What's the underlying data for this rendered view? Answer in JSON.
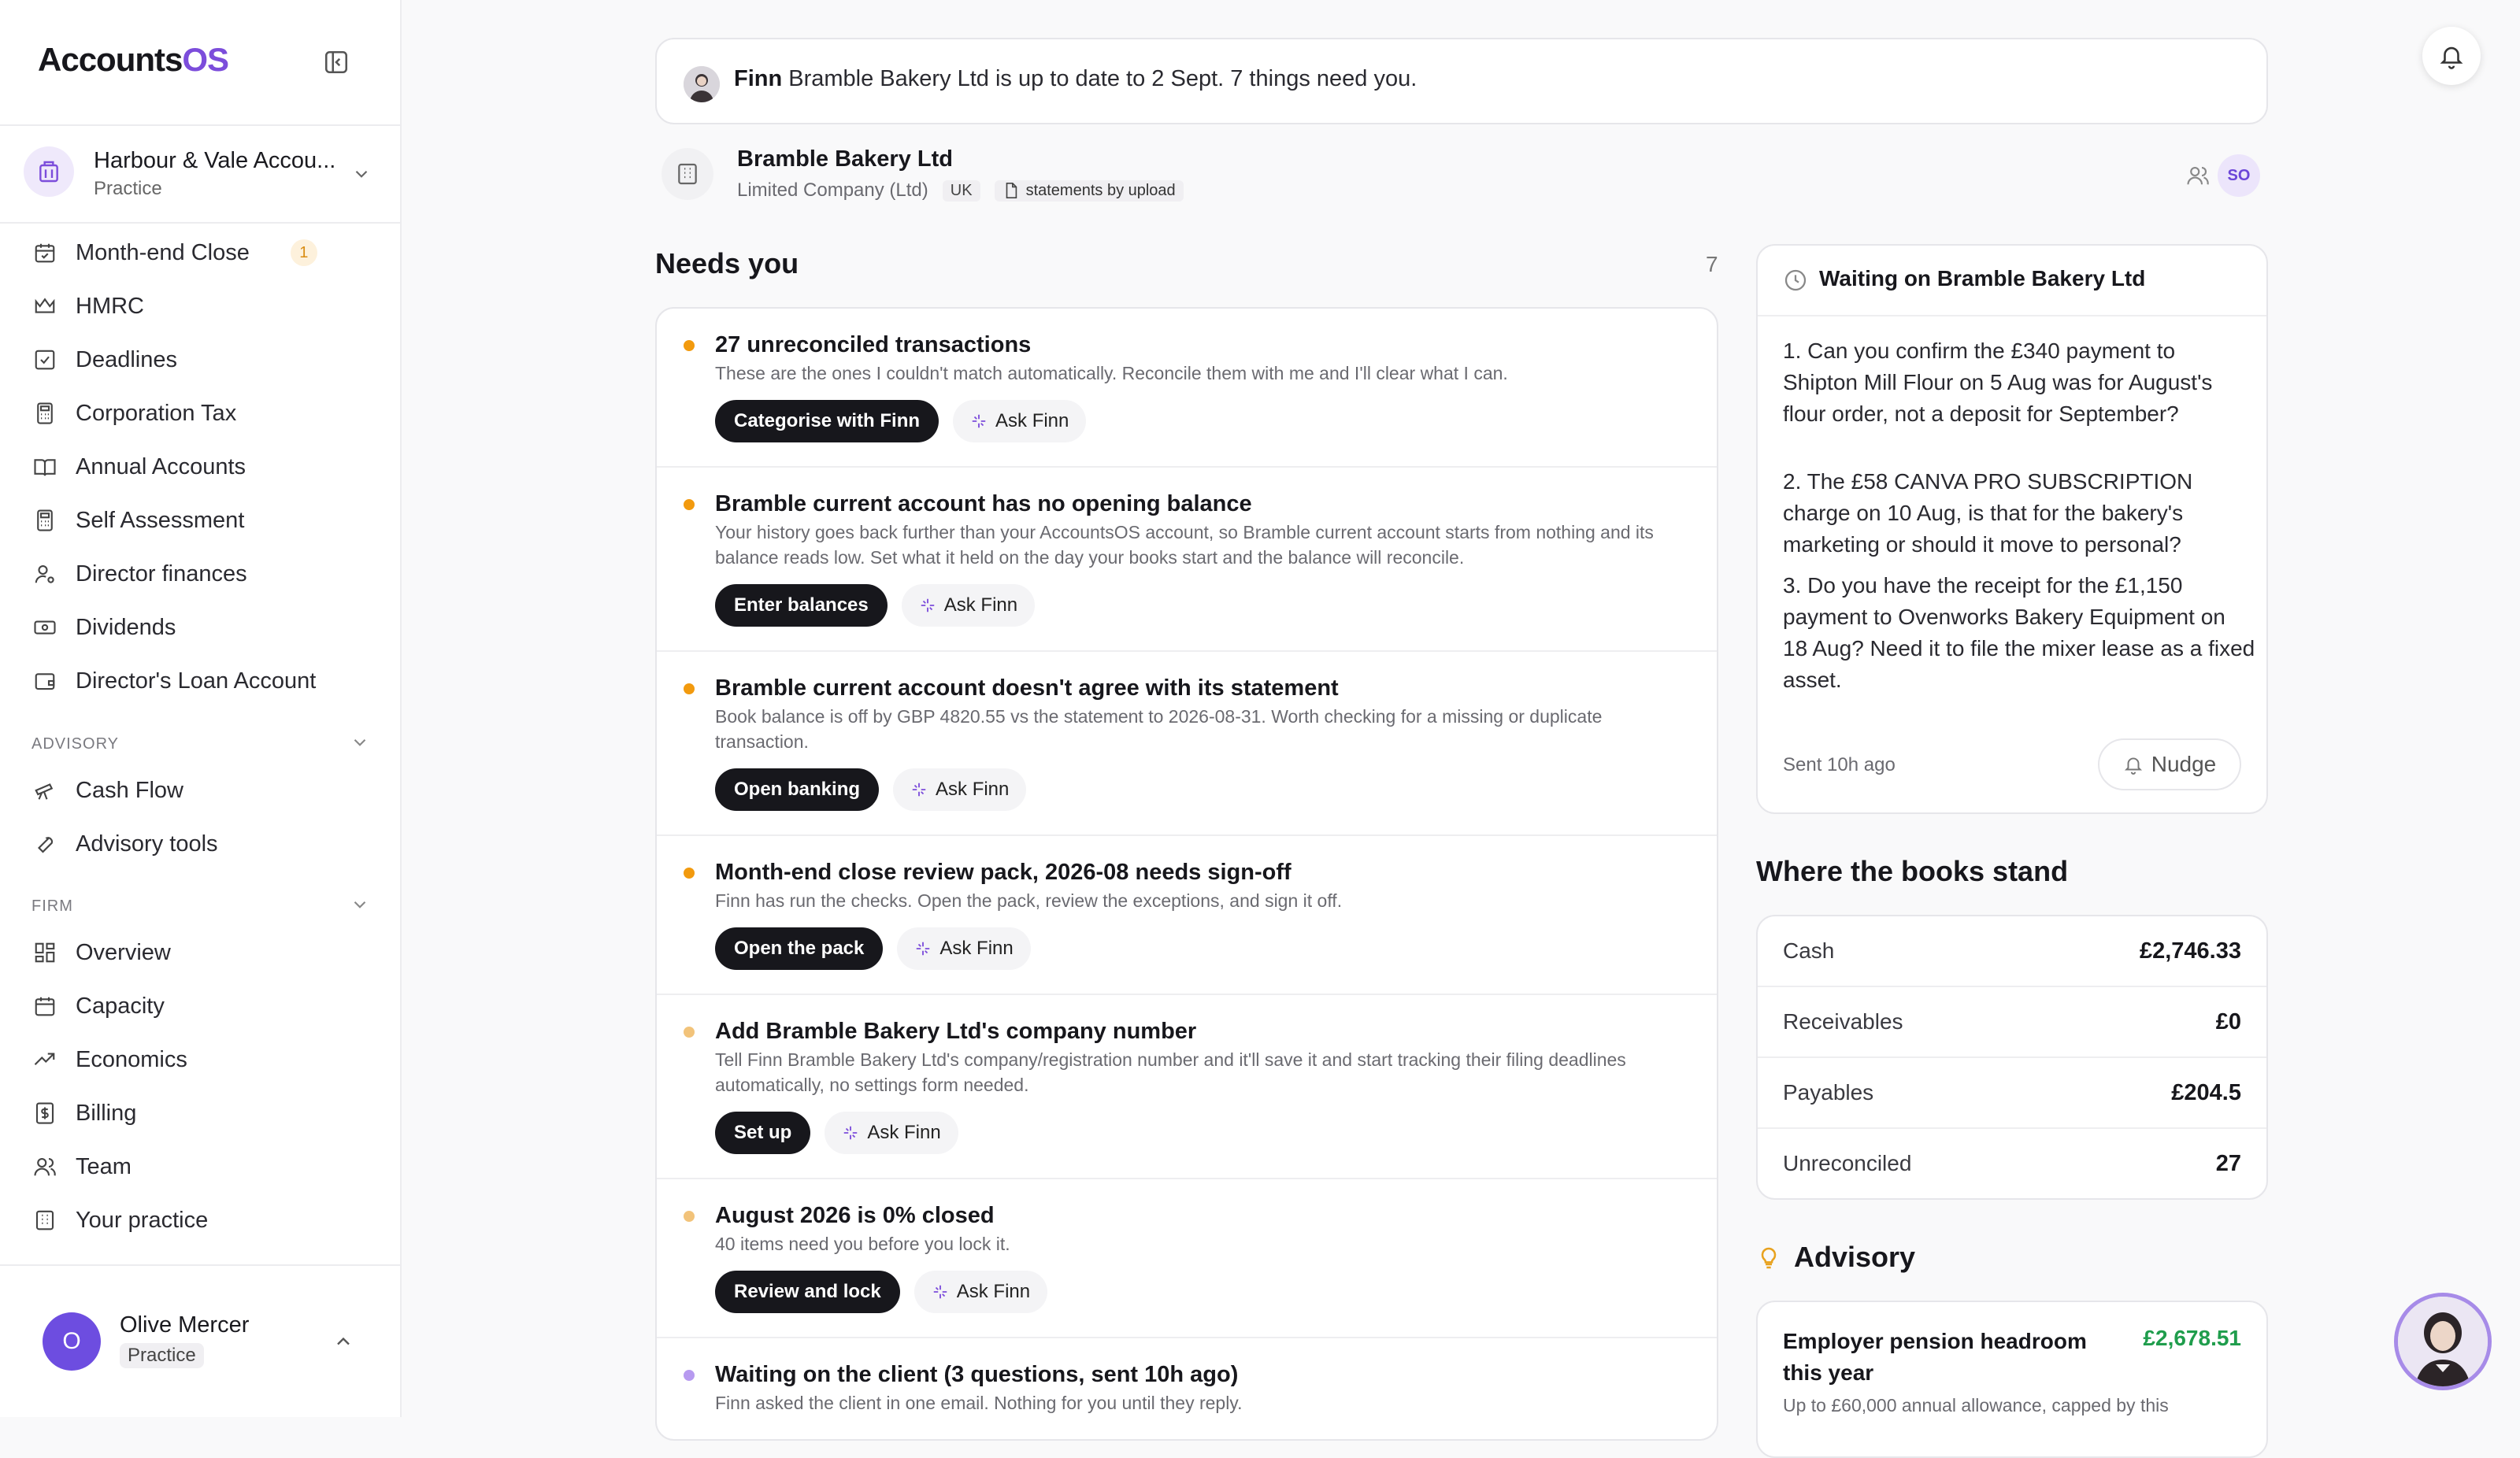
{
  "sidebar": {
    "logo_main": "Accounts",
    "logo_accent": "OS",
    "org": {
      "name": "Harbour & Vale Accou...",
      "type": "Practice"
    },
    "items": [
      {
        "label": "Month-end Close",
        "badge": "1"
      },
      {
        "label": "HMRC"
      },
      {
        "label": "Deadlines"
      },
      {
        "label": "Corporation Tax"
      },
      {
        "label": "Annual Accounts"
      },
      {
        "label": "Self Assessment"
      },
      {
        "label": "Director finances"
      },
      {
        "label": "Dividends"
      },
      {
        "label": "Director's Loan Account"
      }
    ],
    "advisory_label": "ADVISORY",
    "advisory_items": [
      {
        "label": "Cash Flow"
      },
      {
        "label": "Advisory tools"
      }
    ],
    "firm_label": "FIRM",
    "firm_items": [
      {
        "label": "Overview"
      },
      {
        "label": "Capacity"
      },
      {
        "label": "Economics"
      },
      {
        "label": "Billing"
      },
      {
        "label": "Team"
      },
      {
        "label": "Your practice"
      }
    ],
    "user": {
      "initial": "O",
      "name": "Olive Mercer",
      "role": "Practice"
    }
  },
  "banner": {
    "name": "Finn",
    "text": "Bramble Bakery Ltd is up to date to 2 Sept. 7 things need you."
  },
  "company": {
    "name": "Bramble Bakery Ltd",
    "type": "Limited Company (Ltd)",
    "region": "UK",
    "feed": "statements by upload",
    "assignee_initials": "SO"
  },
  "needs": {
    "title": "Needs you",
    "count": "7",
    "ask_label": "Ask Finn",
    "items": [
      {
        "title": "27 unreconciled transactions",
        "desc": "These are the ones I couldn't match automatically. Reconcile them with me and I'll clear what I can.",
        "action": "Categorise with Finn",
        "status_color": "#f29a0e"
      },
      {
        "title": "Bramble current account has no opening balance",
        "desc": "Your history goes back further than your AccountsOS account, so Bramble current account starts from nothing and its balance reads low. Set what it held on the day your books start and the balance will reconcile.",
        "action": "Enter balances",
        "status_color": "#f29a0e"
      },
      {
        "title": "Bramble current account doesn't agree with its statement",
        "desc": "Book balance is off by GBP 4820.55 vs the statement to 2026-08-31. Worth checking for a missing or duplicate transaction.",
        "action": "Open banking",
        "status_color": "#f29a0e"
      },
      {
        "title": "Month-end close review pack, 2026-08 needs sign-off",
        "desc": "Finn has run the checks. Open the pack, review the exceptions, and sign it off.",
        "action": "Open the pack",
        "status_color": "#f29a0e"
      },
      {
        "title": "Add Bramble Bakery Ltd's company number",
        "desc": "Tell Finn Bramble Bakery Ltd's company/registration number and it'll save it and start tracking their filing deadlines automatically, no settings form needed.",
        "action": "Set up",
        "status_color": "#f2c37a"
      },
      {
        "title": "August 2026 is 0% closed",
        "desc": "40 items need you before you lock it.",
        "action": "Review and lock",
        "status_color": "#f2c37a"
      },
      {
        "title": "Waiting on the client (3 questions, sent 10h ago)",
        "desc": "Finn asked the client in one email. Nothing for you until they reply.",
        "status_color": "#b79af0"
      }
    ]
  },
  "waiting": {
    "title": "Waiting on Bramble Bakery Ltd",
    "questions": [
      "1. Can you confirm the £340 payment to Shipton Mill Flour on 5 Aug was for August's flour order, not a deposit for September?",
      "2. The £58 CANVA PRO SUBSCRIPTION charge on 10 Aug, is that for the bakery's marketing or should it move to personal?",
      "3. Do you have the receipt for the £1,150 payment to Ovenworks Bakery Equipment on 18 Aug? Need it to file the mixer lease as a fixed asset."
    ],
    "sent": "Sent 10h ago",
    "nudge": "Nudge"
  },
  "books": {
    "title": "Where the books stand",
    "rows": [
      {
        "label": "Cash",
        "value": "£2,746.33"
      },
      {
        "label": "Receivables",
        "value": "£0"
      },
      {
        "label": "Payables",
        "value": "£204.5"
      },
      {
        "label": "Unreconciled",
        "value": "27"
      }
    ]
  },
  "advisory": {
    "title": "Advisory",
    "card_title": "Employer pension headroom this year",
    "card_value": "£2,678.51",
    "card_desc": "Up to £60,000 annual allowance, capped by this"
  },
  "colors": {
    "accent": "#7c4ddb",
    "positive": "#1f9d4c",
    "warning": "#f29a0e"
  }
}
